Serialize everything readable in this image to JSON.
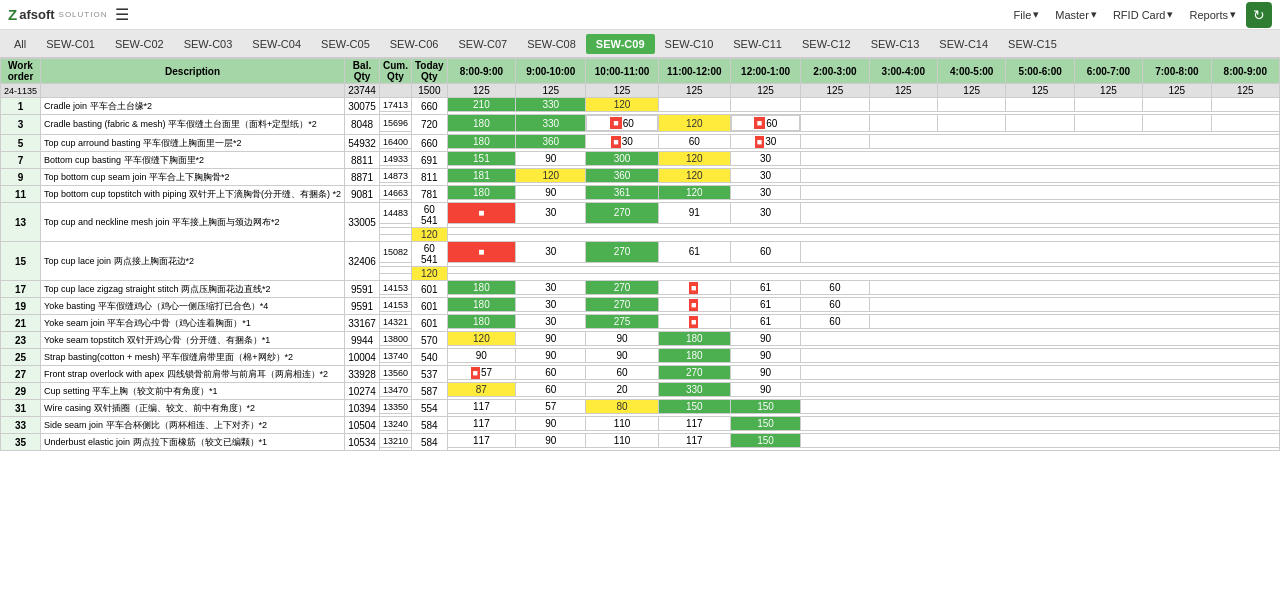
{
  "header": {
    "logo": "Zafsoft",
    "logo_sub": "SOLUTION",
    "file_label": "File",
    "master_label": "Master",
    "rfid_label": "RFID Card",
    "reports_label": "Reports",
    "refresh_icon": "↻"
  },
  "tabs": {
    "items": [
      "All",
      "SEW-C01",
      "SEW-C02",
      "SEW-C03",
      "SEW-C04",
      "SEW-C05",
      "SEW-C06",
      "SEW-C07",
      "SEW-C08",
      "SEW-C09",
      "SEW-C10",
      "SEW-C11",
      "SEW-C12",
      "SEW-C13",
      "SEW-C14",
      "SEW-C15"
    ],
    "active": "SEW-C09"
  },
  "table": {
    "col_headers": [
      "Work\norder",
      "Description",
      "Bal.\nQty",
      "Cum.\nQty",
      "Today\nQty",
      "8:00-9:00",
      "9:00-10:00",
      "10:00-11:00",
      "11:00-12:00",
      "12:00-1:00",
      "2:00-3:00",
      "3:00-4:00",
      "4:00-5:00",
      "5:00-6:00",
      "6:00-7:00",
      "7:00-8:00",
      "8:00-9:00"
    ],
    "total_row": {
      "id": "24-1135",
      "bal": "23744",
      "cum": "",
      "today": "1500",
      "t1": "125",
      "t2": "125",
      "t3": "125",
      "t4": "125",
      "t5": "125",
      "t6": "125",
      "t7": "125",
      "t8": "125",
      "t9": "125",
      "t10": "125",
      "t11": "125",
      "t12": "125"
    }
  }
}
